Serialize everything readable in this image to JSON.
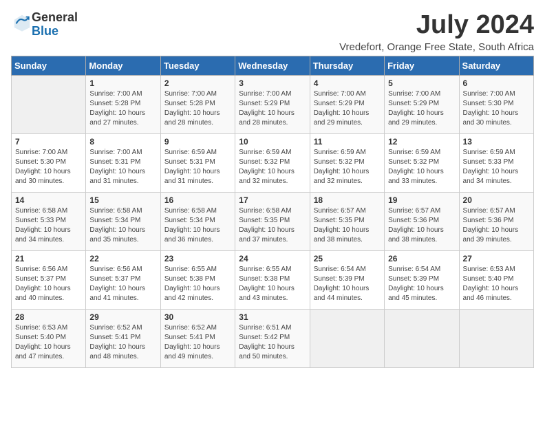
{
  "logo": {
    "text_general": "General",
    "text_blue": "Blue"
  },
  "title": "July 2024",
  "location": "Vredefort, Orange Free State, South Africa",
  "weekdays": [
    "Sunday",
    "Monday",
    "Tuesday",
    "Wednesday",
    "Thursday",
    "Friday",
    "Saturday"
  ],
  "weeks": [
    [
      {
        "day": "",
        "sunrise": "",
        "sunset": "",
        "daylight": ""
      },
      {
        "day": "1",
        "sunrise": "Sunrise: 7:00 AM",
        "sunset": "Sunset: 5:28 PM",
        "daylight": "Daylight: 10 hours and 27 minutes."
      },
      {
        "day": "2",
        "sunrise": "Sunrise: 7:00 AM",
        "sunset": "Sunset: 5:28 PM",
        "daylight": "Daylight: 10 hours and 28 minutes."
      },
      {
        "day": "3",
        "sunrise": "Sunrise: 7:00 AM",
        "sunset": "Sunset: 5:29 PM",
        "daylight": "Daylight: 10 hours and 28 minutes."
      },
      {
        "day": "4",
        "sunrise": "Sunrise: 7:00 AM",
        "sunset": "Sunset: 5:29 PM",
        "daylight": "Daylight: 10 hours and 29 minutes."
      },
      {
        "day": "5",
        "sunrise": "Sunrise: 7:00 AM",
        "sunset": "Sunset: 5:29 PM",
        "daylight": "Daylight: 10 hours and 29 minutes."
      },
      {
        "day": "6",
        "sunrise": "Sunrise: 7:00 AM",
        "sunset": "Sunset: 5:30 PM",
        "daylight": "Daylight: 10 hours and 30 minutes."
      }
    ],
    [
      {
        "day": "7",
        "sunrise": "Sunrise: 7:00 AM",
        "sunset": "Sunset: 5:30 PM",
        "daylight": "Daylight: 10 hours and 30 minutes."
      },
      {
        "day": "8",
        "sunrise": "Sunrise: 7:00 AM",
        "sunset": "Sunset: 5:31 PM",
        "daylight": "Daylight: 10 hours and 31 minutes."
      },
      {
        "day": "9",
        "sunrise": "Sunrise: 6:59 AM",
        "sunset": "Sunset: 5:31 PM",
        "daylight": "Daylight: 10 hours and 31 minutes."
      },
      {
        "day": "10",
        "sunrise": "Sunrise: 6:59 AM",
        "sunset": "Sunset: 5:32 PM",
        "daylight": "Daylight: 10 hours and 32 minutes."
      },
      {
        "day": "11",
        "sunrise": "Sunrise: 6:59 AM",
        "sunset": "Sunset: 5:32 PM",
        "daylight": "Daylight: 10 hours and 32 minutes."
      },
      {
        "day": "12",
        "sunrise": "Sunrise: 6:59 AM",
        "sunset": "Sunset: 5:32 PM",
        "daylight": "Daylight: 10 hours and 33 minutes."
      },
      {
        "day": "13",
        "sunrise": "Sunrise: 6:59 AM",
        "sunset": "Sunset: 5:33 PM",
        "daylight": "Daylight: 10 hours and 34 minutes."
      }
    ],
    [
      {
        "day": "14",
        "sunrise": "Sunrise: 6:58 AM",
        "sunset": "Sunset: 5:33 PM",
        "daylight": "Daylight: 10 hours and 34 minutes."
      },
      {
        "day": "15",
        "sunrise": "Sunrise: 6:58 AM",
        "sunset": "Sunset: 5:34 PM",
        "daylight": "Daylight: 10 hours and 35 minutes."
      },
      {
        "day": "16",
        "sunrise": "Sunrise: 6:58 AM",
        "sunset": "Sunset: 5:34 PM",
        "daylight": "Daylight: 10 hours and 36 minutes."
      },
      {
        "day": "17",
        "sunrise": "Sunrise: 6:58 AM",
        "sunset": "Sunset: 5:35 PM",
        "daylight": "Daylight: 10 hours and 37 minutes."
      },
      {
        "day": "18",
        "sunrise": "Sunrise: 6:57 AM",
        "sunset": "Sunset: 5:35 PM",
        "daylight": "Daylight: 10 hours and 38 minutes."
      },
      {
        "day": "19",
        "sunrise": "Sunrise: 6:57 AM",
        "sunset": "Sunset: 5:36 PM",
        "daylight": "Daylight: 10 hours and 38 minutes."
      },
      {
        "day": "20",
        "sunrise": "Sunrise: 6:57 AM",
        "sunset": "Sunset: 5:36 PM",
        "daylight": "Daylight: 10 hours and 39 minutes."
      }
    ],
    [
      {
        "day": "21",
        "sunrise": "Sunrise: 6:56 AM",
        "sunset": "Sunset: 5:37 PM",
        "daylight": "Daylight: 10 hours and 40 minutes."
      },
      {
        "day": "22",
        "sunrise": "Sunrise: 6:56 AM",
        "sunset": "Sunset: 5:37 PM",
        "daylight": "Daylight: 10 hours and 41 minutes."
      },
      {
        "day": "23",
        "sunrise": "Sunrise: 6:55 AM",
        "sunset": "Sunset: 5:38 PM",
        "daylight": "Daylight: 10 hours and 42 minutes."
      },
      {
        "day": "24",
        "sunrise": "Sunrise: 6:55 AM",
        "sunset": "Sunset: 5:38 PM",
        "daylight": "Daylight: 10 hours and 43 minutes."
      },
      {
        "day": "25",
        "sunrise": "Sunrise: 6:54 AM",
        "sunset": "Sunset: 5:39 PM",
        "daylight": "Daylight: 10 hours and 44 minutes."
      },
      {
        "day": "26",
        "sunrise": "Sunrise: 6:54 AM",
        "sunset": "Sunset: 5:39 PM",
        "daylight": "Daylight: 10 hours and 45 minutes."
      },
      {
        "day": "27",
        "sunrise": "Sunrise: 6:53 AM",
        "sunset": "Sunset: 5:40 PM",
        "daylight": "Daylight: 10 hours and 46 minutes."
      }
    ],
    [
      {
        "day": "28",
        "sunrise": "Sunrise: 6:53 AM",
        "sunset": "Sunset: 5:40 PM",
        "daylight": "Daylight: 10 hours and 47 minutes."
      },
      {
        "day": "29",
        "sunrise": "Sunrise: 6:52 AM",
        "sunset": "Sunset: 5:41 PM",
        "daylight": "Daylight: 10 hours and 48 minutes."
      },
      {
        "day": "30",
        "sunrise": "Sunrise: 6:52 AM",
        "sunset": "Sunset: 5:41 PM",
        "daylight": "Daylight: 10 hours and 49 minutes."
      },
      {
        "day": "31",
        "sunrise": "Sunrise: 6:51 AM",
        "sunset": "Sunset: 5:42 PM",
        "daylight": "Daylight: 10 hours and 50 minutes."
      },
      {
        "day": "",
        "sunrise": "",
        "sunset": "",
        "daylight": ""
      },
      {
        "day": "",
        "sunrise": "",
        "sunset": "",
        "daylight": ""
      },
      {
        "day": "",
        "sunrise": "",
        "sunset": "",
        "daylight": ""
      }
    ]
  ]
}
